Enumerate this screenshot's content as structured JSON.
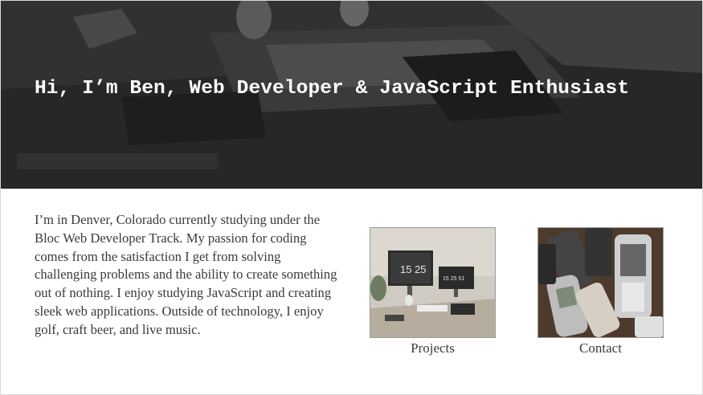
{
  "hero": {
    "title": "Hi, I’m Ben, Web Developer & JavaScript Enthusiast"
  },
  "about": {
    "text": "I’m in Denver, Colorado currently studying under the Bloc Web Developer Track. My passion for coding comes from the satisfaction I get from solving challenging problems and the ability to create something out of nothing. I enjoy studying JavaScript and creating sleek web applications. Outside of technology, I enjoy golf, craft beer, and live music."
  },
  "cards": {
    "projects": {
      "label": "Projects",
      "screen_time_left": "15 25",
      "screen_time_right": "15 25 51"
    },
    "contact": {
      "label": "Contact"
    }
  },
  "colors": {
    "hero_overlay": "#333333",
    "text": "#3a3a3a",
    "white": "#ffffff"
  }
}
